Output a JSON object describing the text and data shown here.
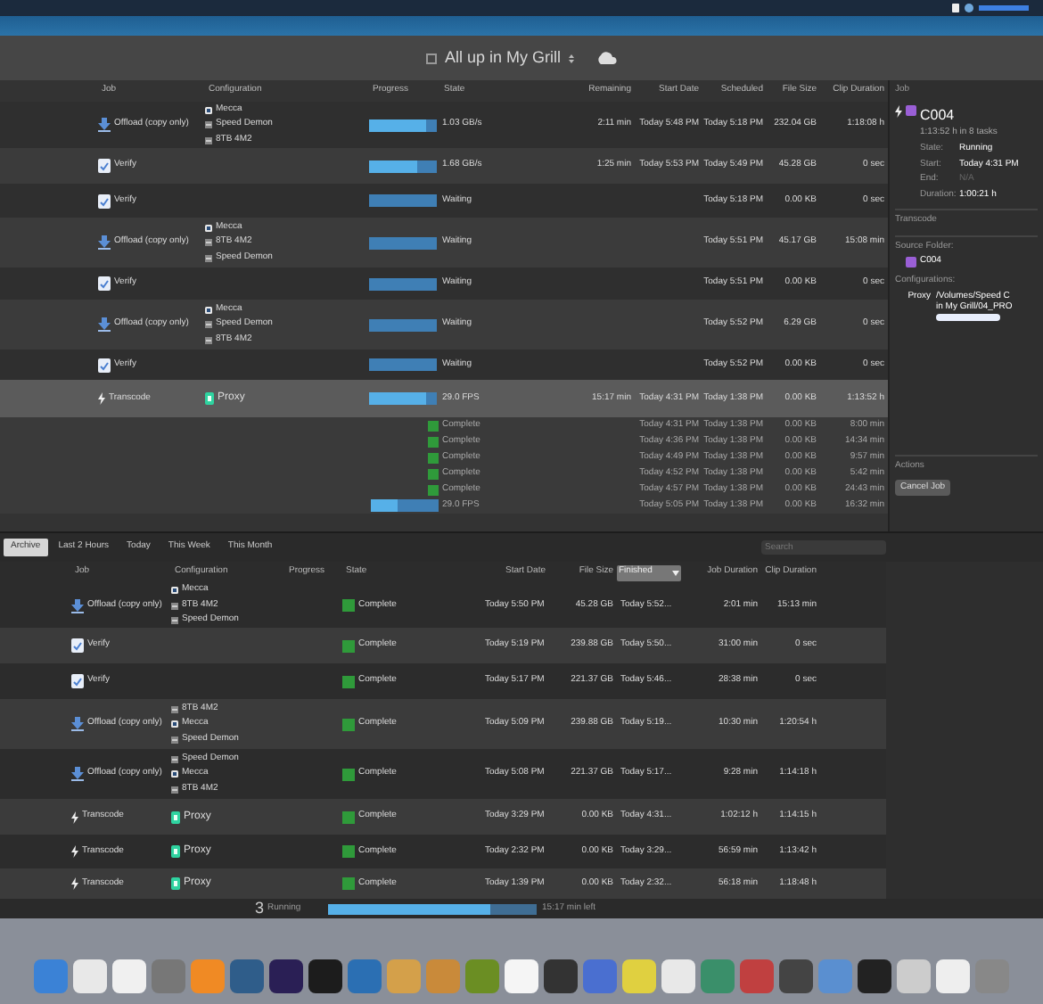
{
  "toolbar": {
    "title": "All up in My Grill"
  },
  "jobs": {
    "columns": [
      "Job",
      "Configuration",
      "Progress",
      "State",
      "Remaining",
      "Start Date",
      "Scheduled",
      "File Size",
      "Clip Duration"
    ],
    "rows": [
      {
        "kind": "offload",
        "job": "Offload (copy only)",
        "configs": [
          {
            "kind": "drive",
            "name": "Mecca"
          },
          {
            "kind": "disk",
            "name": "Speed Demon"
          },
          {
            "kind": "disk",
            "name": "8TB 4M2"
          }
        ],
        "level": 0.85,
        "state": "1.03 GB/s",
        "remaining": "2:11 min",
        "start": "Today 5:48 PM",
        "scheduled": "Today 5:18 PM",
        "size": "232.04 GB",
        "clip": "1:18:08 h",
        "selected": false
      },
      {
        "kind": "verify",
        "job": "Verify",
        "configs": [],
        "level": 0.7,
        "state": "1.68 GB/s",
        "remaining": "1:25 min",
        "start": "Today 5:53 PM",
        "scheduled": "Today 5:49 PM",
        "size": "45.28 GB",
        "clip": "0 sec",
        "selected": false
      },
      {
        "kind": "verify",
        "job": "Verify",
        "configs": [],
        "level": 0,
        "state": "Waiting",
        "scheduled": "Today 5:18 PM",
        "size": "0.00 KB",
        "clip": "0 sec",
        "selected": false
      },
      {
        "kind": "offload",
        "job": "Offload (copy only)",
        "configs": [
          {
            "kind": "drive",
            "name": "Mecca"
          },
          {
            "kind": "disk",
            "name": "8TB 4M2"
          },
          {
            "kind": "disk",
            "name": "Speed Demon"
          }
        ],
        "level": 0,
        "state": "Waiting",
        "scheduled": "Today 5:51 PM",
        "size": "45.17 GB",
        "clip": "15:08 min",
        "selected": false
      },
      {
        "kind": "verify",
        "job": "Verify",
        "configs": [],
        "level": 0,
        "state": "Waiting",
        "scheduled": "Today 5:51 PM",
        "size": "0.00 KB",
        "clip": "0 sec",
        "selected": false
      },
      {
        "kind": "offload",
        "job": "Offload (copy only)",
        "configs": [
          {
            "kind": "drive",
            "name": "Mecca"
          },
          {
            "kind": "disk",
            "name": "Speed Demon"
          },
          {
            "kind": "disk",
            "name": "8TB 4M2"
          }
        ],
        "level": 0,
        "state": "Waiting",
        "scheduled": "Today 5:52 PM",
        "size": "6.29 GB",
        "clip": "0 sec",
        "selected": false
      },
      {
        "kind": "verify",
        "job": "Verify",
        "configs": [],
        "level": 0,
        "state": "Waiting",
        "scheduled": "Today 5:52 PM",
        "size": "0.00 KB",
        "clip": "0 sec",
        "selected": false
      },
      {
        "kind": "transcode",
        "job": "Transcode",
        "configs": [
          {
            "kind": "preset",
            "name": "Proxy"
          }
        ],
        "level": 0.85,
        "state": "29.0 FPS",
        "remaining": "15:17 min",
        "start": "Today 4:31 PM",
        "scheduled": "Today 1:38 PM",
        "size": "0.00 KB",
        "clip": "1:13:52 h",
        "selected": true
      }
    ],
    "tasks": [
      {
        "kind": "complete",
        "state": "Complete",
        "start": "Today 4:31 PM",
        "scheduled": "Today 1:38 PM",
        "size": "0.00 KB",
        "clip": "8:00 min"
      },
      {
        "kind": "complete",
        "state": "Complete",
        "start": "Today 4:36 PM",
        "scheduled": "Today 1:38 PM",
        "size": "0.00 KB",
        "clip": "14:34 min"
      },
      {
        "kind": "complete",
        "state": "Complete",
        "start": "Today 4:49 PM",
        "scheduled": "Today 1:38 PM",
        "size": "0.00 KB",
        "clip": "9:57 min"
      },
      {
        "kind": "complete",
        "state": "Complete",
        "start": "Today 4:52 PM",
        "scheduled": "Today 1:38 PM",
        "size": "0.00 KB",
        "clip": "5:42 min"
      },
      {
        "kind": "complete",
        "state": "Complete",
        "start": "Today 4:57 PM",
        "scheduled": "Today 1:38 PM",
        "size": "0.00 KB",
        "clip": "24:43 min"
      },
      {
        "kind": "running",
        "level": 0.4,
        "state": "29.0 FPS",
        "start": "Today 5:05 PM",
        "scheduled": "Today 1:38 PM",
        "size": "0.00 KB",
        "clip": "16:32 min"
      }
    ]
  },
  "inspector": {
    "header": "Job",
    "name": "C004",
    "subtitle": "1:13:52 h in 8 tasks",
    "fields": [
      {
        "label": "State:",
        "value": "Running",
        "dimmed": false
      },
      {
        "label": "Start:",
        "value": "Today 4:31 PM",
        "dimmed": false
      },
      {
        "label": "End:",
        "value": "N/A",
        "dimmed": true
      },
      {
        "label": "Duration:",
        "value": "1:00:21 h",
        "dimmed": false
      }
    ],
    "section": "Transcode",
    "source_label": "Source Folder:",
    "source": "C004",
    "configurations_label": "Configurations:",
    "configuration": "Proxy",
    "path_lines": [
      "/Volumes/Speed C",
      "in My Grill/04_PRO"
    ],
    "actions_label": "Actions",
    "cancel_button": "Cancel Job"
  },
  "history": {
    "tabs": [
      {
        "label": "Archive",
        "selected": true
      },
      {
        "label": "Last 2 Hours",
        "selected": false
      },
      {
        "label": "Today",
        "selected": false
      },
      {
        "label": "This Week",
        "selected": false
      },
      {
        "label": "This Month",
        "selected": false
      }
    ],
    "search": {
      "placeholder": "Search"
    },
    "columns": [
      "Job",
      "Configuration",
      "Progress",
      "State",
      "Start Date",
      "File Size",
      "Finished",
      "Job Duration",
      "Clip Duration"
    ],
    "rows": [
      {
        "kind": "offload",
        "job": "Offload (copy only)",
        "configs": [
          {
            "kind": "drive",
            "name": "Mecca"
          },
          {
            "kind": "disk",
            "name": "8TB 4M2"
          },
          {
            "kind": "disk",
            "name": "Speed Demon"
          }
        ],
        "state": "Complete",
        "start": "Today 5:50 PM",
        "size": "45.28 GB",
        "finished": "Today 5:52...",
        "job_duration": "2:01 min",
        "clip": "15:13 min"
      },
      {
        "kind": "verify",
        "job": "Verify",
        "configs": [],
        "state": "Complete",
        "start": "Today 5:19 PM",
        "size": "239.88 GB",
        "finished": "Today 5:50...",
        "job_duration": "31:00 min",
        "clip": "0 sec"
      },
      {
        "kind": "verify",
        "job": "Verify",
        "configs": [],
        "state": "Complete",
        "start": "Today 5:17 PM",
        "size": "221.37 GB",
        "finished": "Today 5:46...",
        "job_duration": "28:38 min",
        "clip": "0 sec"
      },
      {
        "kind": "offload",
        "job": "Offload (copy only)",
        "configs": [
          {
            "kind": "disk",
            "name": "8TB 4M2"
          },
          {
            "kind": "drive",
            "name": "Mecca"
          },
          {
            "kind": "disk",
            "name": "Speed Demon"
          }
        ],
        "state": "Complete",
        "start": "Today 5:09 PM",
        "size": "239.88 GB",
        "finished": "Today 5:19...",
        "job_duration": "10:30 min",
        "clip": "1:20:54 h"
      },
      {
        "kind": "offload",
        "job": "Offload (copy only)",
        "configs": [
          {
            "kind": "disk",
            "name": "Speed Demon"
          },
          {
            "kind": "drive",
            "name": "Mecca"
          },
          {
            "kind": "disk",
            "name": "8TB 4M2"
          }
        ],
        "state": "Complete",
        "start": "Today 5:08 PM",
        "size": "221.37 GB",
        "finished": "Today 5:17...",
        "job_duration": "9:28 min",
        "clip": "1:14:18 h"
      },
      {
        "kind": "transcode",
        "job": "Transcode",
        "configs": [
          {
            "kind": "preset",
            "name": "Proxy"
          }
        ],
        "state": "Complete",
        "start": "Today 3:29 PM",
        "size": "0.00 KB",
        "finished": "Today 4:31...",
        "job_duration": "1:02:12 h",
        "clip": "1:14:15 h"
      },
      {
        "kind": "transcode",
        "job": "Transcode",
        "configs": [
          {
            "kind": "preset",
            "name": "Proxy"
          }
        ],
        "state": "Complete",
        "start": "Today 2:32 PM",
        "size": "0.00 KB",
        "finished": "Today 3:29...",
        "job_duration": "56:59 min",
        "clip": "1:13:42 h"
      },
      {
        "kind": "transcode",
        "job": "Transcode",
        "configs": [
          {
            "kind": "preset",
            "name": "Proxy"
          }
        ],
        "state": "Complete",
        "start": "Today 1:39 PM",
        "size": "0.00 KB",
        "finished": "Today 2:32...",
        "job_duration": "56:18 min",
        "clip": "1:18:48 h"
      }
    ]
  },
  "status": {
    "count": "3",
    "label": "Running",
    "level": 0.78,
    "remaining": "15:17 min left"
  }
}
